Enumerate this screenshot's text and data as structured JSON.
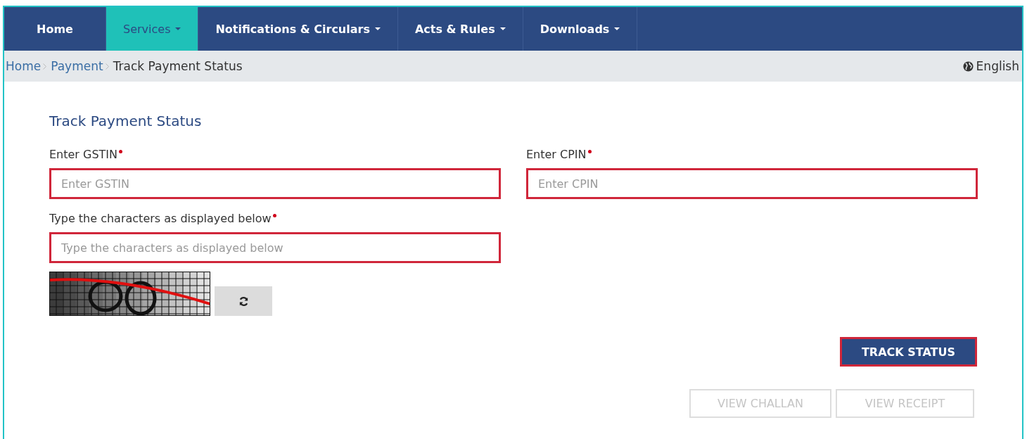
{
  "nav": [
    {
      "label": "Home",
      "selected": false,
      "dropdown": false
    },
    {
      "label": "Services",
      "selected": true,
      "dropdown": true
    },
    {
      "label": "Notifications & Circulars",
      "selected": false,
      "dropdown": true
    },
    {
      "label": "Acts & Rules",
      "selected": false,
      "dropdown": true
    },
    {
      "label": "Downloads",
      "selected": false,
      "dropdown": true
    }
  ],
  "breadcrumb": [
    {
      "label": "Home",
      "link": true
    },
    {
      "label": "Payment",
      "link": true
    },
    {
      "label": "Track Payment Status",
      "link": false
    }
  ],
  "language": "English",
  "form": {
    "title": "Track Payment Status",
    "fields": [
      {
        "label": "Enter GSTIN",
        "required": true,
        "placeholder": "Enter GSTIN",
        "highlighted": true
      },
      {
        "label": "Enter CPIN",
        "required": true,
        "placeholder": "Enter CPIN",
        "highlighted": true
      },
      {
        "label": "Type the characters as displayed below",
        "required": true,
        "placeholder": "Type the characters as displayed below",
        "highlighted": true
      }
    ],
    "buttons": [
      {
        "label": "TRACK STATUS",
        "disabled": false,
        "highlighted": true
      },
      {
        "label": "VIEW CHALLAN",
        "disabled": true,
        "highlighted": false
      },
      {
        "label": "VIEW RECEIPT",
        "disabled": true,
        "highlighted": false
      }
    ]
  }
}
